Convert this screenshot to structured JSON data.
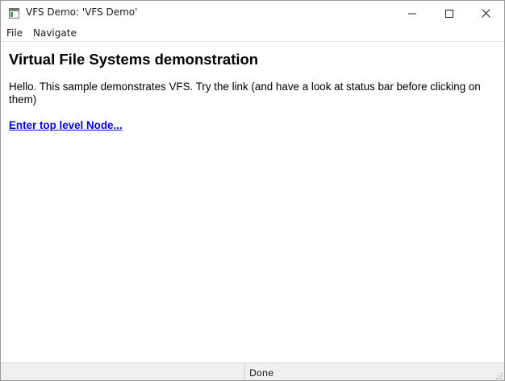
{
  "window": {
    "title": "VFS Demo: 'VFS Demo'"
  },
  "menu": {
    "file": "File",
    "navigate": "Navigate"
  },
  "content": {
    "heading": "Virtual File Systems demonstration",
    "intro": "Hello. This sample demonstrates VFS. Try the link (and have a look at status bar before clicking on them)",
    "link": "Enter top level Node..."
  },
  "status": {
    "text": "Done"
  },
  "icons": {
    "app": "app-window-icon",
    "minimize": "minimize-icon",
    "maximize": "maximize-icon",
    "close": "close-icon",
    "grip": "size-grip-icon"
  },
  "colors": {
    "link": "#0000ee",
    "status_bar": "#f0f0f0"
  }
}
